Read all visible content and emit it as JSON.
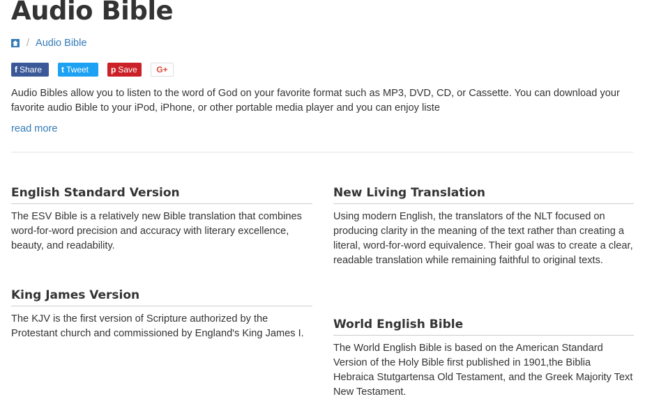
{
  "page": {
    "title": "Audio Bible"
  },
  "breadcrumb": {
    "home_icon": "home-icon",
    "separator": "/",
    "current": "Audio Bible"
  },
  "share": {
    "facebook": {
      "icon": "f",
      "label": "Share"
    },
    "twitter": {
      "icon": "t",
      "label": "Tweet"
    },
    "pinterest": {
      "icon": "p",
      "label": "Save"
    },
    "googleplus": {
      "label": "G+"
    }
  },
  "intro": {
    "text": "Audio Bibles allow you to listen to the word of God on your favorite format such as MP3, DVD, CD, or Cassette. You can download your favorite audio Bible to your iPod, iPhone, or other portable media player and you can enjoy liste",
    "read_more": "read more"
  },
  "versions": [
    {
      "title": "English Standard Version",
      "description": "The ESV Bible is a relatively new Bible translation that combines word-for-word precision and accuracy with literary excellence, beauty, and readability."
    },
    {
      "title": "New Living Translation",
      "description": "Using modern English, the translators of the NLT focused on producing clarity in the meaning of the text rather than creating a literal, word-for-word equivalence. Their goal was to create a clear, readable translation while remaining faithful to original texts."
    },
    {
      "title": "King James Version",
      "description": "The KJV is the first version of Scripture authorized by the Protestant church and commissioned by England's King James I."
    },
    {
      "title": "World English Bible",
      "description": "The World English Bible is based on the American Standard Version of the Holy Bible first published in 1901,the Biblia Hebraica Stutgartensa Old Testament, and the Greek Majority Text New Testament."
    }
  ],
  "colors": {
    "link": "#337ab7",
    "facebook": "#3b5998",
    "twitter": "#1da1f2",
    "pinterest": "#cb2027",
    "googleplus": "#dd4b39"
  }
}
